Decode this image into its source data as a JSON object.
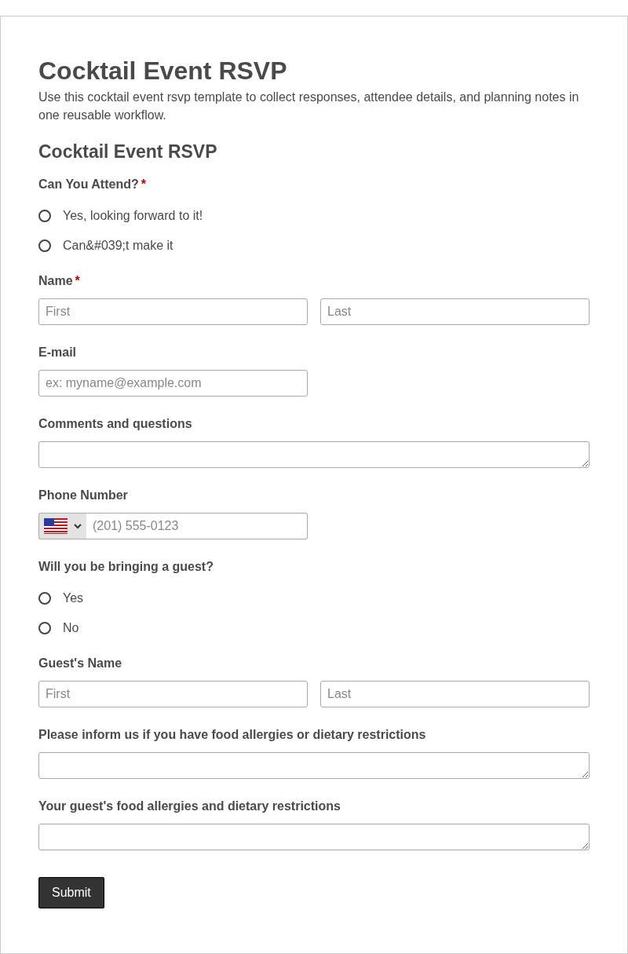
{
  "title": "Cocktail Event RSVP",
  "description": "Use this cocktail event rsvp template to collect responses, attendee details, and planning notes in one reusable workflow.",
  "form_title": "Cocktail Event RSVP",
  "fields": [
    {
      "kind": "radio",
      "label": "Can You Attend?",
      "required_mark": "*",
      "options": [
        {
          "label": "Yes, looking forward to it!",
          "selected": false
        },
        {
          "label": "Can&#039;t make it",
          "selected": false
        }
      ]
    },
    {
      "kind": "name",
      "label": "Name",
      "required_mark": "*",
      "placeholders": [
        "First",
        "Last"
      ]
    },
    {
      "kind": "email",
      "label": "E-mail",
      "placeholder": "ex: myname@example.com"
    },
    {
      "kind": "textarea",
      "label": "Comments and questions"
    },
    {
      "kind": "phone",
      "label": "Phone Number",
      "placeholder": "(201) 555-0123"
    },
    {
      "kind": "radio",
      "label": "Will you be bringing a guest?",
      "options": [
        {
          "label": "Yes",
          "selected": false
        },
        {
          "label": "No",
          "selected": false
        }
      ]
    },
    {
      "kind": "name",
      "label": "Guest's Name",
      "placeholders": [
        "First",
        "Last"
      ]
    },
    {
      "kind": "textarea",
      "label": "Please inform us if you have food allergies or dietary restrictions"
    },
    {
      "kind": "textarea",
      "label": "Your guest's food allergies and dietary restrictions"
    }
  ],
  "submit": "Submit"
}
